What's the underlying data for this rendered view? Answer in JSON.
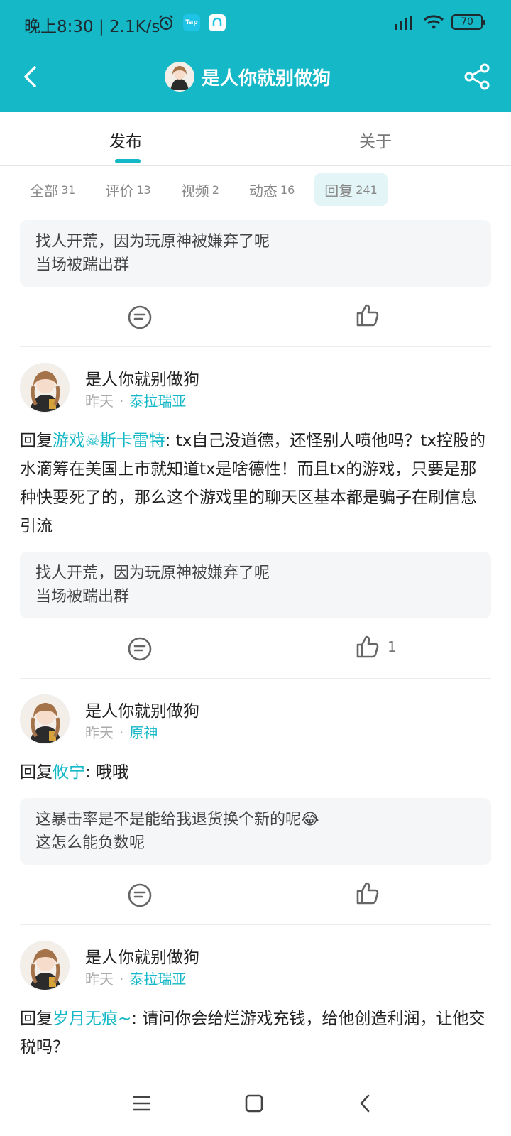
{
  "status_bar": {
    "time": "晚上8:30 | 2.1K/s",
    "tap_badge": "Tap",
    "battery": "70"
  },
  "header": {
    "title": "是人你就别做狗"
  },
  "tabs": [
    {
      "label": "发布",
      "active": true
    },
    {
      "label": "关于",
      "active": false
    }
  ],
  "chips": [
    {
      "label": "全部",
      "count": "31"
    },
    {
      "label": "评价",
      "count": "13"
    },
    {
      "label": "视频",
      "count": "2"
    },
    {
      "label": "动态",
      "count": "16"
    },
    {
      "label": "回复",
      "count": "241"
    }
  ],
  "partial_post": {
    "quote": [
      "找人开荒，因为玩原神被嫌弃了呢",
      "当场被踹出群"
    ]
  },
  "posts": [
    {
      "author": "是人你就别做狗",
      "time": "昨天",
      "game": "泰拉瑞亚",
      "reply_prefix": "回复",
      "mention": "游戏☠斯卡雷特",
      "reply_body": ": tx自己没道德，还怪别人喷他吗？tx控股的水滴筹在美国上市就知道tx是啥德性！而且tx的游戏，只要是那种快要死了的，那么这个游戏里的聊天区基本都是骗子在刷信息引流",
      "quote": [
        "找人开荒，因为玩原神被嫌弃了呢",
        "当场被踹出群"
      ],
      "likes": "1"
    },
    {
      "author": "是人你就别做狗",
      "time": "昨天",
      "game": "原神",
      "reply_prefix": "回复",
      "mention": "攸宁",
      "reply_body": ": 哦哦",
      "quote": [
        "这暴击率是不是能给我退货换个新的呢😂",
        "这怎么能负数呢"
      ],
      "likes": ""
    },
    {
      "author": "是人你就别做狗",
      "time": "昨天",
      "game": "泰拉瑞亚",
      "reply_prefix": "回复",
      "mention": "岁月无痕~",
      "reply_body": ": 请问你会给烂游戏充钱，给他创造利润，让他交税吗？"
    }
  ],
  "colors": {
    "accent": "#15b8c6",
    "header_bg": "#15b8c6",
    "quote_bg": "#f5f6f8"
  },
  "icons": [
    "back-icon",
    "share-icon",
    "comment-icon",
    "like-icon",
    "menu-icon",
    "home-icon",
    "nav-back-icon",
    "alarm-icon",
    "signal-icon",
    "wifi-icon",
    "battery-icon"
  ]
}
